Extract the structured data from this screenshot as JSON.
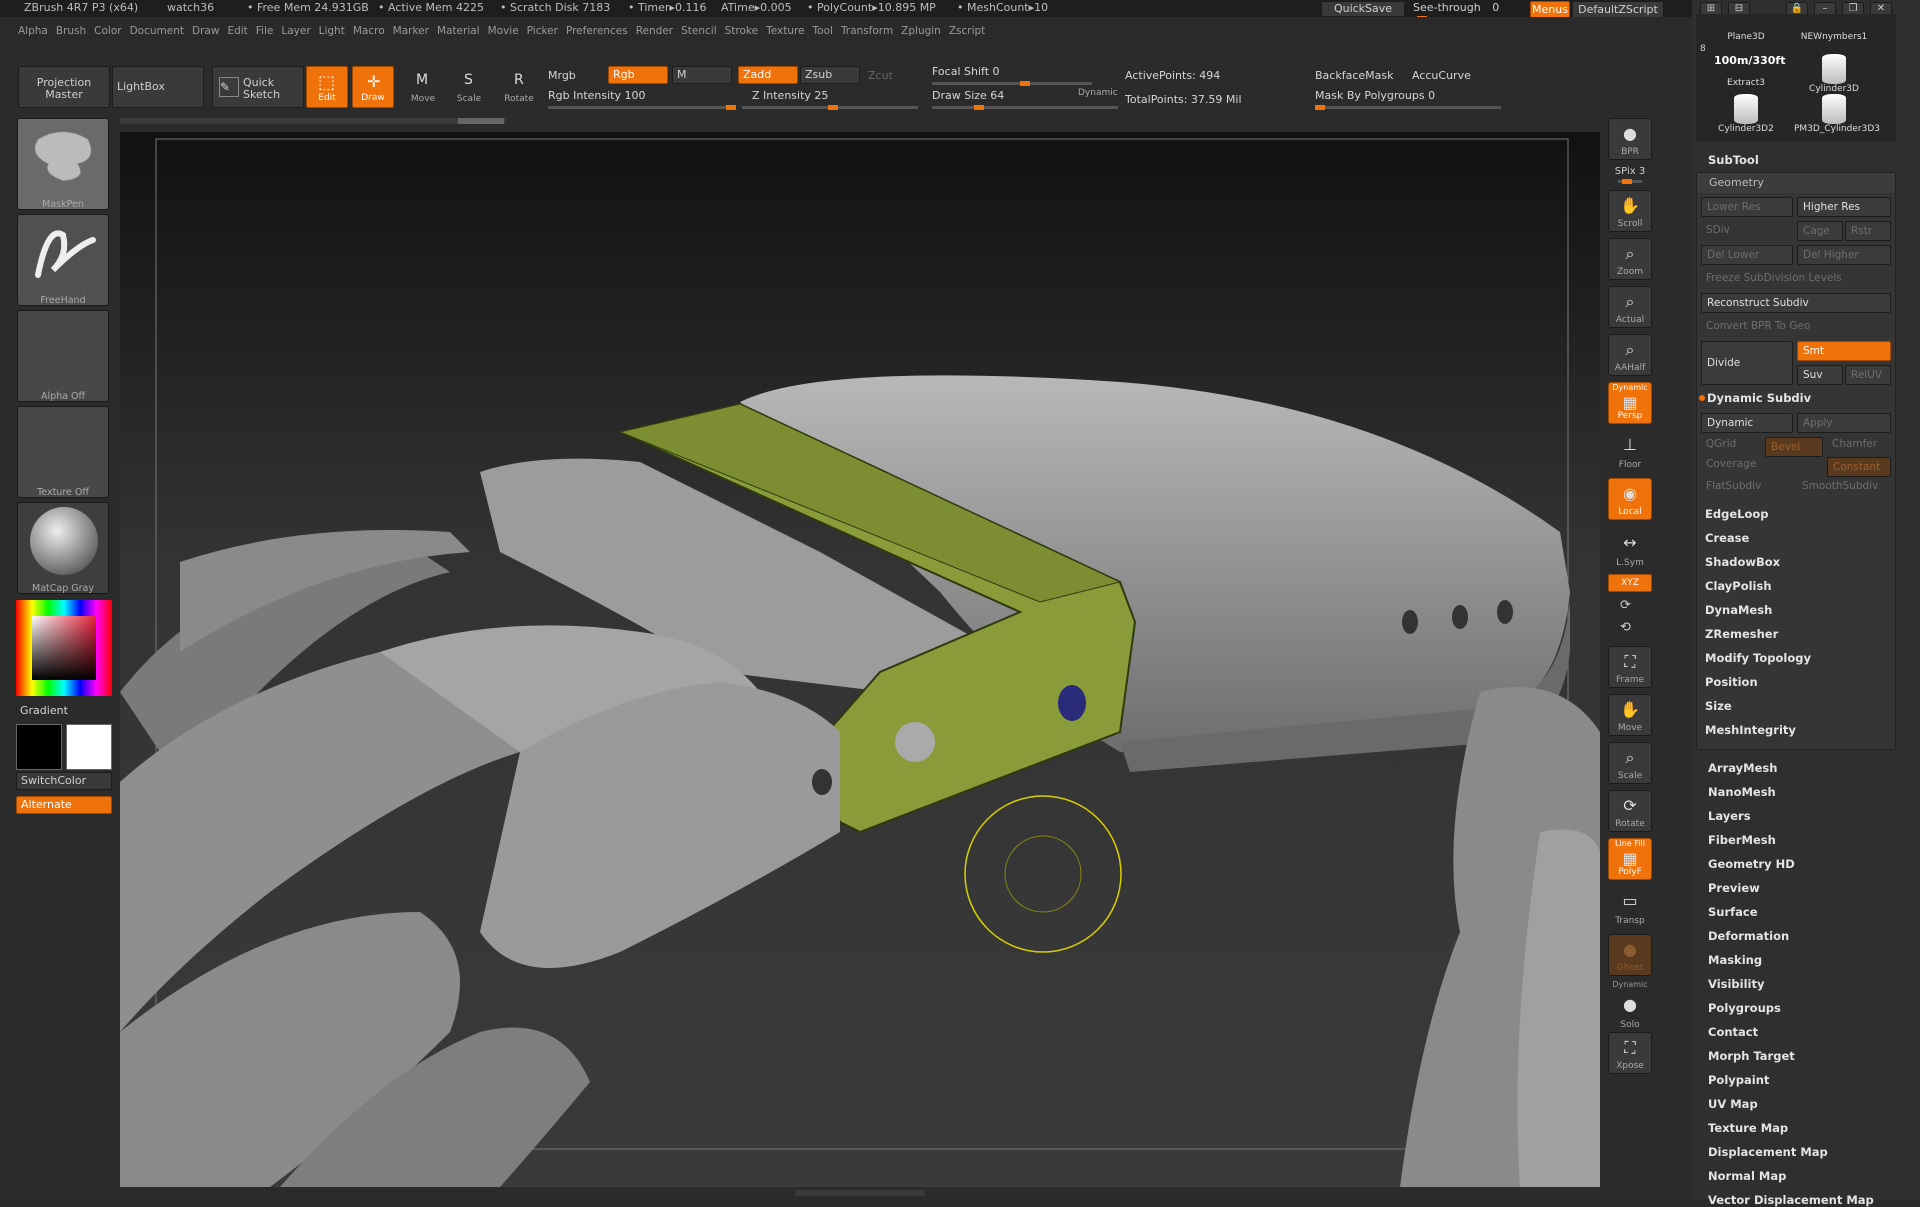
{
  "title": {
    "app": "ZBrush 4R7 P3 (x64)",
    "doc": "watch36",
    "free_mem": "• Free Mem 24.931GB",
    "active_mem": "• Active Mem 4225",
    "scratch": "• Scratch Disk 7183",
    "timer": "• Timer▸0.116",
    "atime": "ATime▸0.005",
    "polycount": "• PolyCount▸10.895 MP",
    "meshcount": "• MeshCount▸10"
  },
  "topright": {
    "quicksave": "QuickSave",
    "seethrough": "See-through",
    "seethrough_val": "0",
    "menus": "Menus",
    "script": "DefaultZScript"
  },
  "menus": [
    "Alpha",
    "Brush",
    "Color",
    "Document",
    "Draw",
    "Edit",
    "File",
    "Layer",
    "Light",
    "Macro",
    "Marker",
    "Material",
    "Movie",
    "Picker",
    "Preferences",
    "Render",
    "Stencil",
    "Stroke",
    "Texture",
    "Tool",
    "Transform",
    "Zplugin",
    "Zscript"
  ],
  "toolbar": {
    "projection_master": "Projection Master",
    "lightbox": "LightBox",
    "quick_sketch": "Quick Sketch",
    "edit": "Edit",
    "draw": "Draw",
    "move": "Move",
    "scale": "Scale",
    "rotate": "Rotate",
    "mrgb": "Mrgb",
    "rgb": "Rgb",
    "m": "M",
    "rgb_intensity": "Rgb Intensity 100",
    "zadd": "Zadd",
    "zsub": "Zsub",
    "zcut": "Zcut",
    "z_intensity": "Z Intensity 25",
    "focal_shift": "Focal Shift 0",
    "draw_size": "Draw Size 64",
    "dynamic": "Dynamic",
    "active_points": "ActivePoints: 494",
    "total_points": "TotalPoints: 37.59 Mil",
    "backface_mask": "BackfaceMask",
    "accucurve": "AccuCurve",
    "mask_polygroups": "Mask By Polygroups 0"
  },
  "left": {
    "brush": "MaskPen",
    "stroke": "FreeHand",
    "alpha": "Alpha Off",
    "texture": "Texture Off",
    "material": "MatCap Gray",
    "gradient": "Gradient",
    "switchcolor": "SwitchColor",
    "alternate": "Alternate"
  },
  "right_shelf": {
    "bpr": "BPR",
    "spix": "SPix 3",
    "scroll": "Scroll",
    "zoom": "Zoom",
    "actual": "Actual",
    "aahalf": "AAHalf",
    "persp": "Persp",
    "dynamic": "Dynamic",
    "floor": "Floor",
    "local": "Local",
    "lsym": "L.Sym",
    "xyz": "XYZ",
    "frame": "Frame",
    "move": "Move",
    "scale": "Scale",
    "rotate": "Rotate",
    "polyf": "PolyF",
    "linefill": "Line Fill",
    "transp": "Transp",
    "ghost": "Ghost",
    "solo": "Solo",
    "dynamic2": "Dynamic",
    "xpose": "Xpose"
  },
  "subtools": [
    {
      "label": "Plane3D"
    },
    {
      "label": "NEWnymbers1"
    },
    {
      "label": "Extract3"
    },
    {
      "label": "Cylinder3D"
    },
    {
      "label": "Cylinder3D2"
    },
    {
      "label": "PM3D_Cylinder3D3"
    }
  ],
  "subtool_count": "8",
  "thumb_text": "100m/330ft",
  "panel": {
    "subtool": "SubTool",
    "geometry": "Geometry",
    "lower_res": "Lower Res",
    "higher_res": "Higher Res",
    "sdiv": "SDiv",
    "cage": "Cage",
    "rstr": "Rstr",
    "del_lower": "Del Lower",
    "del_higher": "Del Higher",
    "freeze": "Freeze SubDivision Levels",
    "reconstruct": "Reconstruct Subdiv",
    "convert_bpr": "Convert BPR To Geo",
    "divide": "Divide",
    "smt": "Smt",
    "suv": "Suv",
    "reuv": "RelUV",
    "dynamic_subdiv": "Dynamic Subdiv",
    "dynamic": "Dynamic",
    "apply": "Apply",
    "qgrid": "QGrid",
    "bevel": "Bevel",
    "chamfer": "Chamfer",
    "coverage": "Coverage",
    "constant": "Constant",
    "flatsubdiv": "FlatSubdiv",
    "smoothsubdiv": "SmoothSubdiv",
    "geo_items": [
      "EdgeLoop",
      "Crease",
      "ShadowBox",
      "ClayPolish",
      "DynaMesh",
      "ZRemesher",
      "Modify Topology",
      "Position",
      "Size",
      "MeshIntegrity"
    ],
    "tool_items": [
      "ArrayMesh",
      "NanoMesh",
      "Layers",
      "FiberMesh",
      "Geometry HD",
      "Preview",
      "Surface",
      "Deformation",
      "Masking",
      "Visibility",
      "Polygroups",
      "Contact",
      "Morph Target",
      "Polypaint",
      "UV Map",
      "Texture Map",
      "Displacement Map",
      "Normal Map",
      "Vector Displacement Map"
    ]
  },
  "colors": {
    "accent": "#f0720b",
    "bg": "#2b2b2b",
    "highlight": "#8a9b3a"
  }
}
